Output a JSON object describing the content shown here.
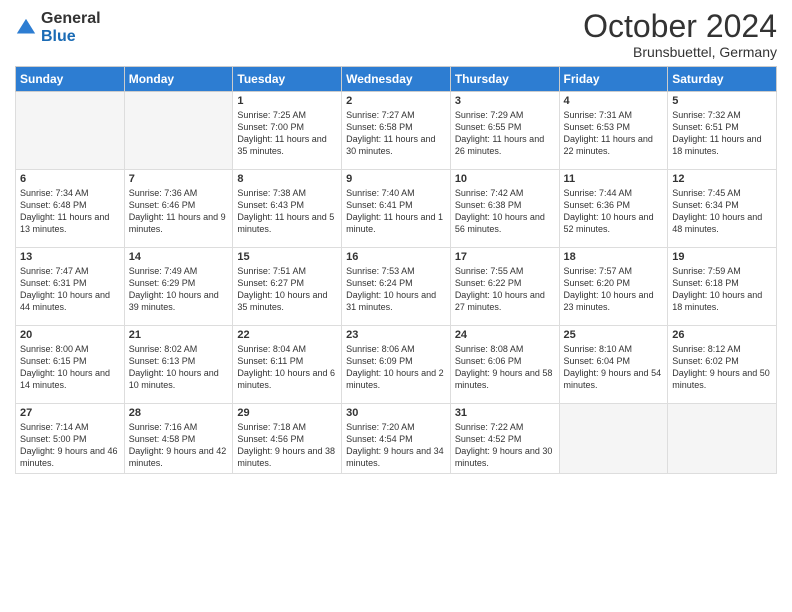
{
  "header": {
    "logo_general": "General",
    "logo_blue": "Blue",
    "title": "October 2024",
    "location": "Brunsbuettel, Germany"
  },
  "weekdays": [
    "Sunday",
    "Monday",
    "Tuesday",
    "Wednesday",
    "Thursday",
    "Friday",
    "Saturday"
  ],
  "weeks": [
    [
      {
        "day": "",
        "empty": true
      },
      {
        "day": "",
        "empty": true
      },
      {
        "day": "1",
        "sunrise": "Sunrise: 7:25 AM",
        "sunset": "Sunset: 7:00 PM",
        "daylight": "Daylight: 11 hours and 35 minutes."
      },
      {
        "day": "2",
        "sunrise": "Sunrise: 7:27 AM",
        "sunset": "Sunset: 6:58 PM",
        "daylight": "Daylight: 11 hours and 30 minutes."
      },
      {
        "day": "3",
        "sunrise": "Sunrise: 7:29 AM",
        "sunset": "Sunset: 6:55 PM",
        "daylight": "Daylight: 11 hours and 26 minutes."
      },
      {
        "day": "4",
        "sunrise": "Sunrise: 7:31 AM",
        "sunset": "Sunset: 6:53 PM",
        "daylight": "Daylight: 11 hours and 22 minutes."
      },
      {
        "day": "5",
        "sunrise": "Sunrise: 7:32 AM",
        "sunset": "Sunset: 6:51 PM",
        "daylight": "Daylight: 11 hours and 18 minutes."
      }
    ],
    [
      {
        "day": "6",
        "sunrise": "Sunrise: 7:34 AM",
        "sunset": "Sunset: 6:48 PM",
        "daylight": "Daylight: 11 hours and 13 minutes."
      },
      {
        "day": "7",
        "sunrise": "Sunrise: 7:36 AM",
        "sunset": "Sunset: 6:46 PM",
        "daylight": "Daylight: 11 hours and 9 minutes."
      },
      {
        "day": "8",
        "sunrise": "Sunrise: 7:38 AM",
        "sunset": "Sunset: 6:43 PM",
        "daylight": "Daylight: 11 hours and 5 minutes."
      },
      {
        "day": "9",
        "sunrise": "Sunrise: 7:40 AM",
        "sunset": "Sunset: 6:41 PM",
        "daylight": "Daylight: 11 hours and 1 minute."
      },
      {
        "day": "10",
        "sunrise": "Sunrise: 7:42 AM",
        "sunset": "Sunset: 6:38 PM",
        "daylight": "Daylight: 10 hours and 56 minutes."
      },
      {
        "day": "11",
        "sunrise": "Sunrise: 7:44 AM",
        "sunset": "Sunset: 6:36 PM",
        "daylight": "Daylight: 10 hours and 52 minutes."
      },
      {
        "day": "12",
        "sunrise": "Sunrise: 7:45 AM",
        "sunset": "Sunset: 6:34 PM",
        "daylight": "Daylight: 10 hours and 48 minutes."
      }
    ],
    [
      {
        "day": "13",
        "sunrise": "Sunrise: 7:47 AM",
        "sunset": "Sunset: 6:31 PM",
        "daylight": "Daylight: 10 hours and 44 minutes."
      },
      {
        "day": "14",
        "sunrise": "Sunrise: 7:49 AM",
        "sunset": "Sunset: 6:29 PM",
        "daylight": "Daylight: 10 hours and 39 minutes."
      },
      {
        "day": "15",
        "sunrise": "Sunrise: 7:51 AM",
        "sunset": "Sunset: 6:27 PM",
        "daylight": "Daylight: 10 hours and 35 minutes."
      },
      {
        "day": "16",
        "sunrise": "Sunrise: 7:53 AM",
        "sunset": "Sunset: 6:24 PM",
        "daylight": "Daylight: 10 hours and 31 minutes."
      },
      {
        "day": "17",
        "sunrise": "Sunrise: 7:55 AM",
        "sunset": "Sunset: 6:22 PM",
        "daylight": "Daylight: 10 hours and 27 minutes."
      },
      {
        "day": "18",
        "sunrise": "Sunrise: 7:57 AM",
        "sunset": "Sunset: 6:20 PM",
        "daylight": "Daylight: 10 hours and 23 minutes."
      },
      {
        "day": "19",
        "sunrise": "Sunrise: 7:59 AM",
        "sunset": "Sunset: 6:18 PM",
        "daylight": "Daylight: 10 hours and 18 minutes."
      }
    ],
    [
      {
        "day": "20",
        "sunrise": "Sunrise: 8:00 AM",
        "sunset": "Sunset: 6:15 PM",
        "daylight": "Daylight: 10 hours and 14 minutes."
      },
      {
        "day": "21",
        "sunrise": "Sunrise: 8:02 AM",
        "sunset": "Sunset: 6:13 PM",
        "daylight": "Daylight: 10 hours and 10 minutes."
      },
      {
        "day": "22",
        "sunrise": "Sunrise: 8:04 AM",
        "sunset": "Sunset: 6:11 PM",
        "daylight": "Daylight: 10 hours and 6 minutes."
      },
      {
        "day": "23",
        "sunrise": "Sunrise: 8:06 AM",
        "sunset": "Sunset: 6:09 PM",
        "daylight": "Daylight: 10 hours and 2 minutes."
      },
      {
        "day": "24",
        "sunrise": "Sunrise: 8:08 AM",
        "sunset": "Sunset: 6:06 PM",
        "daylight": "Daylight: 9 hours and 58 minutes."
      },
      {
        "day": "25",
        "sunrise": "Sunrise: 8:10 AM",
        "sunset": "Sunset: 6:04 PM",
        "daylight": "Daylight: 9 hours and 54 minutes."
      },
      {
        "day": "26",
        "sunrise": "Sunrise: 8:12 AM",
        "sunset": "Sunset: 6:02 PM",
        "daylight": "Daylight: 9 hours and 50 minutes."
      }
    ],
    [
      {
        "day": "27",
        "sunrise": "Sunrise: 7:14 AM",
        "sunset": "Sunset: 5:00 PM",
        "daylight": "Daylight: 9 hours and 46 minutes."
      },
      {
        "day": "28",
        "sunrise": "Sunrise: 7:16 AM",
        "sunset": "Sunset: 4:58 PM",
        "daylight": "Daylight: 9 hours and 42 minutes."
      },
      {
        "day": "29",
        "sunrise": "Sunrise: 7:18 AM",
        "sunset": "Sunset: 4:56 PM",
        "daylight": "Daylight: 9 hours and 38 minutes."
      },
      {
        "day": "30",
        "sunrise": "Sunrise: 7:20 AM",
        "sunset": "Sunset: 4:54 PM",
        "daylight": "Daylight: 9 hours and 34 minutes."
      },
      {
        "day": "31",
        "sunrise": "Sunrise: 7:22 AM",
        "sunset": "Sunset: 4:52 PM",
        "daylight": "Daylight: 9 hours and 30 minutes."
      },
      {
        "day": "",
        "empty": true
      },
      {
        "day": "",
        "empty": true
      }
    ]
  ]
}
